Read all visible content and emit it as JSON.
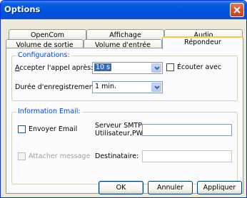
{
  "window": {
    "title": "Options"
  },
  "tabs": {
    "row_top": [
      "OpenCom",
      "Affichage",
      "Audio"
    ],
    "row_bottom": [
      "Volume de sortie",
      "Volume d'entrée",
      "Répondeur"
    ],
    "active": "Répondeur"
  },
  "configurations": {
    "title": "Configurations:",
    "accept_label": "Accepter l'appel après:",
    "accept_value": "10 s",
    "listen_label": "Écouter avec",
    "listen_checked": false,
    "duration_label": "Durée d'enregistrement:",
    "duration_value": "1 min."
  },
  "email": {
    "title": "Information Email:",
    "send_label": "Envoyer Email",
    "send_checked": false,
    "attach_label": "Attacher message",
    "attach_checked": false,
    "smtp_label_line1": "Serveur SMTP:",
    "smtp_label_line2": "Utilisateur,PW:",
    "smtp_value": "",
    "recipient_label": "Destinataire:",
    "recipient_value": ""
  },
  "buttons": {
    "ok": "OK",
    "cancel": "Annuler",
    "apply": "Appliquer"
  }
}
